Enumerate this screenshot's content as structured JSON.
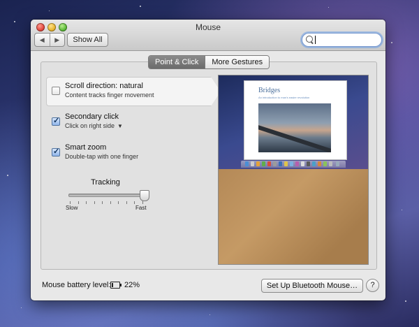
{
  "window": {
    "title": "Mouse"
  },
  "toolbar": {
    "back_icon": "left-arrow",
    "forward_icon": "right-arrow",
    "show_all_label": "Show All",
    "search_value": "",
    "search_icon": "magnifier-icon"
  },
  "tabs": [
    {
      "label": "Point & Click",
      "selected": true
    },
    {
      "label": "More Gestures",
      "selected": false
    }
  ],
  "options": {
    "scroll": {
      "title": "Scroll direction: natural",
      "subtitle": "Content tracks finger movement",
      "checked": false
    },
    "secondary": {
      "title": "Secondary click",
      "subtitle": "Click on right side",
      "checked": true
    },
    "zoom": {
      "title": "Smart zoom",
      "subtitle": "Double-tap with one finger",
      "checked": true
    }
  },
  "tracking": {
    "label": "Tracking",
    "min_label": "Slow",
    "max_label": "Fast",
    "value_fraction": 1.0,
    "tick_count": 10
  },
  "preview": {
    "page_title": "Bridges",
    "page_subtitle": "An introduction to man's easier revolution"
  },
  "footer": {
    "battery_label": "Mouse battery level:",
    "battery_value": "22%",
    "battery_fraction": 0.22,
    "setup_label": "Set Up Bluetooth Mouse…",
    "help_label": "?"
  },
  "colors": {
    "window_bg": "#e8e8e8",
    "selected_tab": "#777777",
    "checkbox_on": "#8fb5ea"
  }
}
